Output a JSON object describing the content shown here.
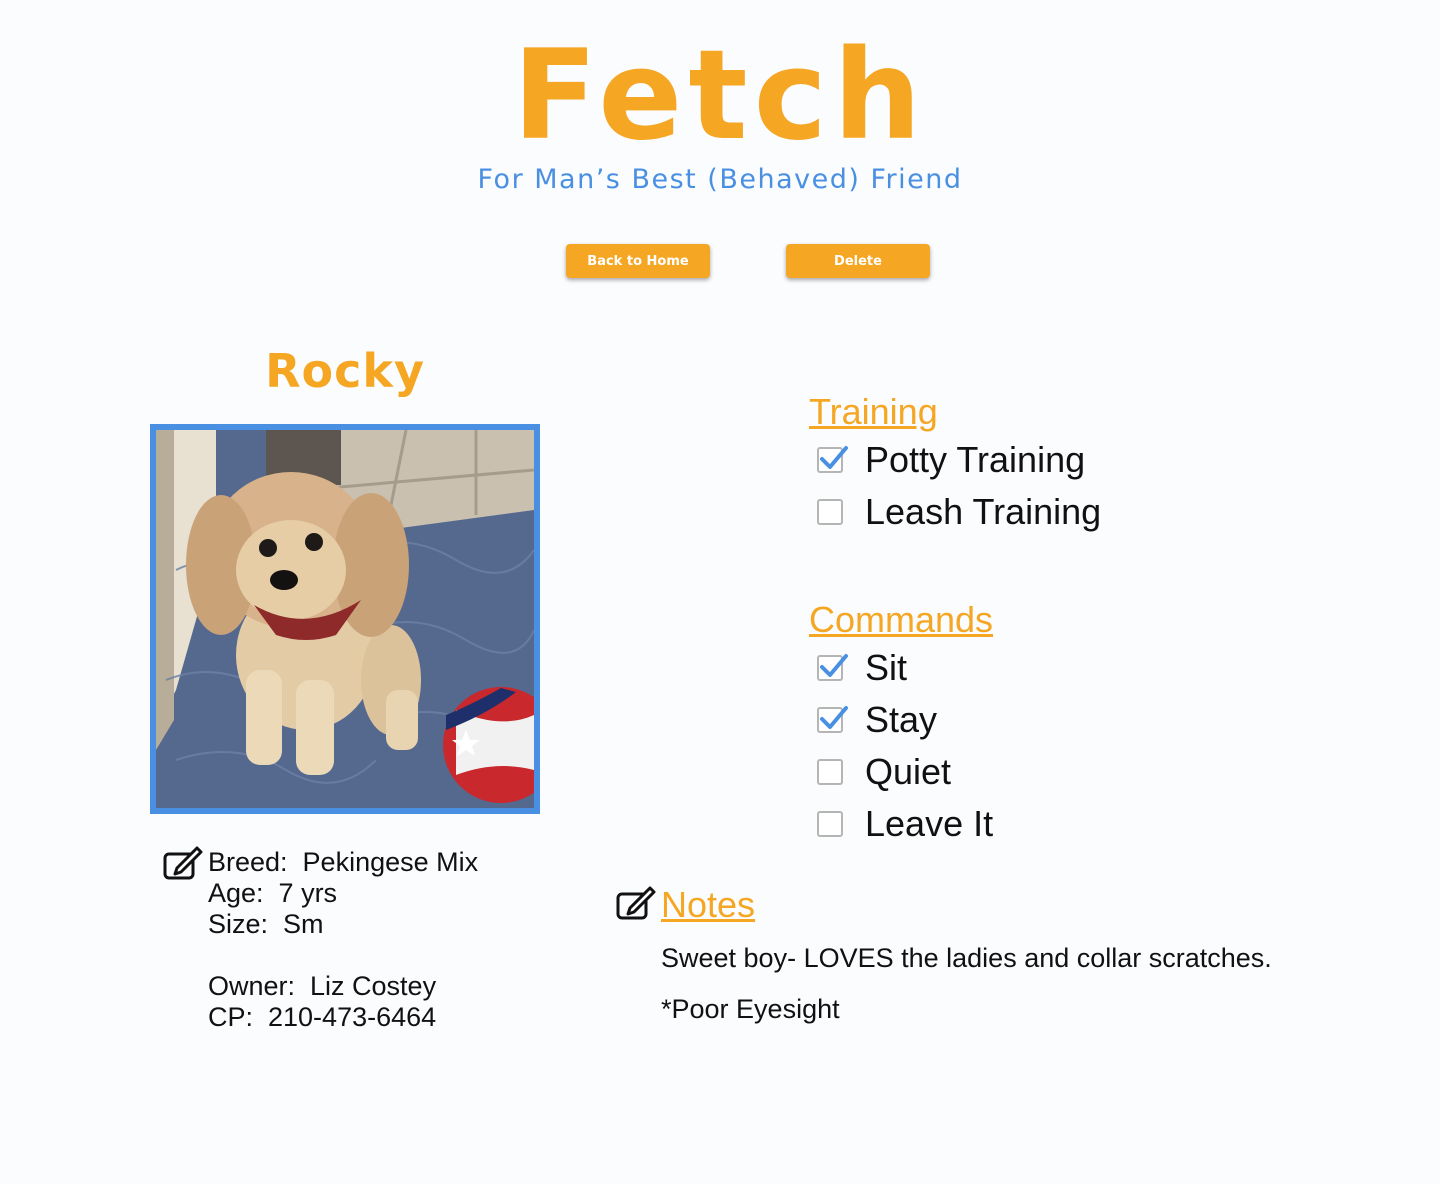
{
  "header": {
    "title": "Fetch",
    "tagline": "For Man’s Best (Behaved) Friend"
  },
  "actions": {
    "back_label": "Back to Home",
    "delete_label": "Delete"
  },
  "dog": {
    "name": "Rocky",
    "breed_line": "Breed:  Pekingese Mix",
    "age_line": "Age:  7 yrs",
    "size_line": "Size:  Sm",
    "owner_line": "Owner:  Liz Costey",
    "phone_line": "CP:  210-473-6464"
  },
  "training": {
    "title": "Training",
    "items": [
      {
        "label": "Potty Training",
        "checked": true
      },
      {
        "label": "Leash Training",
        "checked": false
      }
    ]
  },
  "commands": {
    "title": "Commands",
    "items": [
      {
        "label": "Sit",
        "checked": true
      },
      {
        "label": "Stay",
        "checked": true
      },
      {
        "label": "Quiet",
        "checked": false
      },
      {
        "label": "Leave It",
        "checked": false
      }
    ]
  },
  "notes": {
    "title": "Notes",
    "lines": [
      "Sweet boy- LOVES the ladies and collar scratches.",
      "*Poor Eyesight"
    ]
  },
  "colors": {
    "accent_orange": "#f5a623",
    "accent_blue": "#4a90e2",
    "check_blue": "#4a90e2"
  },
  "icons": {
    "edit": "edit-pencil-icon",
    "checkmark": "checkmark-icon"
  }
}
